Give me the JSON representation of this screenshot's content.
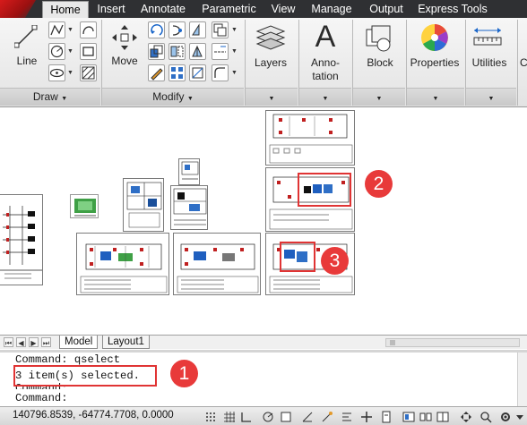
{
  "ribbon": {
    "tabs": [
      {
        "label": "Home",
        "active": true
      },
      {
        "label": "Insert",
        "active": false
      },
      {
        "label": "Annotate",
        "active": false
      },
      {
        "label": "Parametric",
        "active": false
      },
      {
        "label": "View",
        "active": false
      },
      {
        "label": "Manage",
        "active": false
      },
      {
        "label": "Output",
        "active": false
      },
      {
        "label": "Express Tools",
        "active": false
      }
    ],
    "panels": {
      "draw": {
        "label": "Draw",
        "line_label": "Line"
      },
      "modify": {
        "label": "Modify",
        "move_label": "Move"
      },
      "layers_label": "Layers",
      "annotation_label": "Anno-\ntation",
      "annotation_big": "A",
      "block_label": "Block",
      "properties_label": "Properties",
      "utilities_label": "Utilities"
    }
  },
  "drawing": {
    "callouts": [
      {
        "number": "2"
      },
      {
        "number": "3"
      },
      {
        "number": "1"
      }
    ]
  },
  "layout_tabs": {
    "tabs": [
      {
        "label": "Model",
        "active": true
      },
      {
        "label": "Layout1",
        "active": false
      }
    ]
  },
  "command_line": {
    "lines": [
      "Command: qselect",
      "3 item(s) selected.",
      "Command:",
      "Command:"
    ]
  },
  "status_bar": {
    "coordinates": "140796.8539, -64774.7708, 0.0000"
  },
  "colors": {
    "highlight": "#e03434",
    "badge": "#e83a3a",
    "tabbar": "#2f3033"
  }
}
